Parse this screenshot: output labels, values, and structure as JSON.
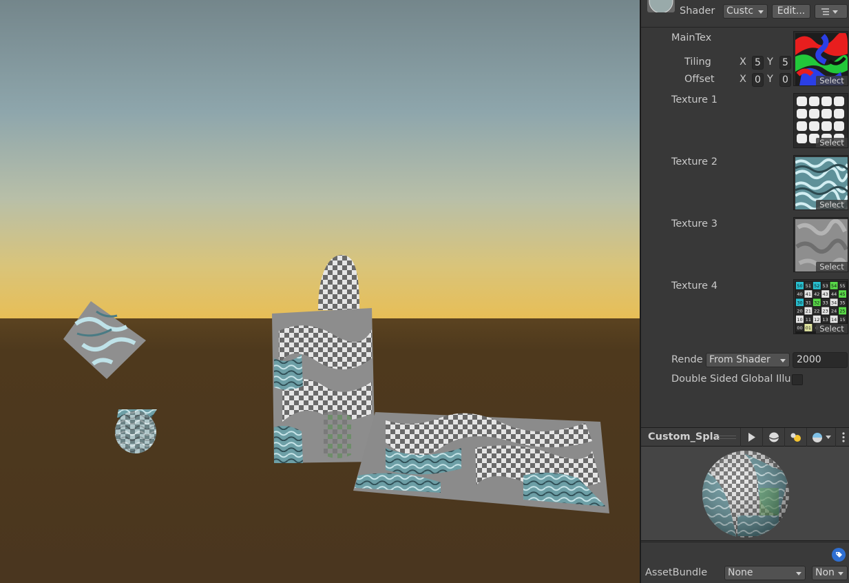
{
  "header": {
    "shader_label": "Shader",
    "shader_value": "Custc",
    "edit_button": "Edit...",
    "menu_icon": "list-settings-icon"
  },
  "properties": {
    "maintex": {
      "label": "MainTex",
      "tiling_label": "Tiling",
      "offset_label": "Offset",
      "tiling_x_label": "X",
      "tiling_x": "5",
      "tiling_y_label": "Y",
      "tiling_y": "5",
      "offset_x_label": "X",
      "offset_x": "0",
      "offset_y_label": "Y",
      "offset_y": "0",
      "select": "Select"
    },
    "textures": [
      {
        "label": "Texture 1",
        "select": "Select"
      },
      {
        "label": "Texture 2",
        "select": "Select"
      },
      {
        "label": "Texture 3",
        "select": "Select"
      },
      {
        "label": "Texture 4",
        "select": "Select"
      }
    ],
    "uv_grid_numbers": [
      [
        "50",
        "51",
        "52",
        "53",
        "54",
        "55"
      ],
      [
        "40",
        "41",
        "42",
        "43",
        "44",
        "45"
      ],
      [
        "30",
        "31",
        "32",
        "33",
        "34",
        "35"
      ],
      [
        "20",
        "21",
        "22",
        "23",
        "24",
        "25"
      ],
      [
        "10",
        "11",
        "12",
        "13",
        "14",
        "15"
      ],
      [
        "00",
        "01",
        "0"
      ]
    ],
    "render_queue_label": "Rende",
    "render_queue_mode": "From Shader",
    "render_queue_value": "2000",
    "double_sided_gi_label": "Double Sided Global Illu"
  },
  "preview": {
    "title": "Custom_Spla",
    "icons": [
      "play-icon",
      "sphere-icon",
      "light-icon",
      "preview-mesh-icon",
      "more-icon"
    ]
  },
  "asset_bundle": {
    "label": "AssetBundle",
    "name_value": "None",
    "variant_value": "Non",
    "tag_icon": "asset-label-icon"
  },
  "colors": {
    "sky_top": "#74868b",
    "sky_horizon": "#e8c060",
    "ground": "#4b371d",
    "panel_bg": "#383838",
    "blue_accent": "#2f6fd1"
  }
}
